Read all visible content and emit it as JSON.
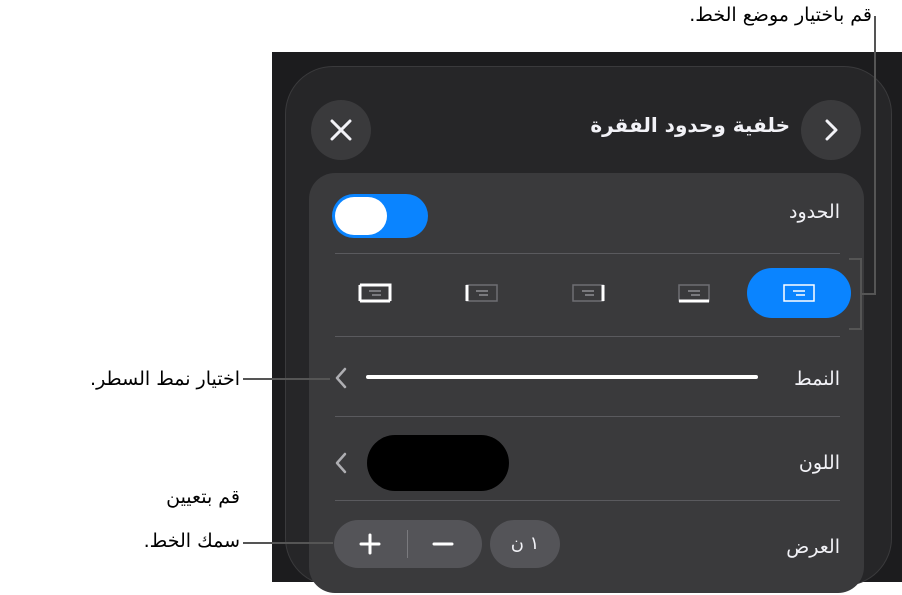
{
  "panel": {
    "title": "خلفية وحدود الفقرة",
    "close_icon": "close-icon",
    "forward_icon": "chevron-right-icon"
  },
  "borders": {
    "label": "الحدود",
    "enabled": true
  },
  "position_options": [
    {
      "name": "all-borders",
      "selected": true
    },
    {
      "name": "bottom-border",
      "selected": false
    },
    {
      "name": "right-border",
      "selected": false
    },
    {
      "name": "left-border",
      "selected": false
    },
    {
      "name": "top-and-sides",
      "selected": false
    }
  ],
  "style": {
    "label": "النمط"
  },
  "color": {
    "label": "اللون",
    "value": "#000000"
  },
  "width": {
    "label": "العرض",
    "value": "١ ن",
    "plus": "+",
    "minus": "−"
  },
  "callouts": {
    "position": "قم باختيار موضع الخط.",
    "style": "اختيار نمط السطر.",
    "thickness_line1": "قم بتعيين",
    "thickness_line2": "سمك الخط."
  },
  "colors": {
    "accent": "#0a84ff",
    "panel": "#262628",
    "card": "#3a3a3c"
  }
}
